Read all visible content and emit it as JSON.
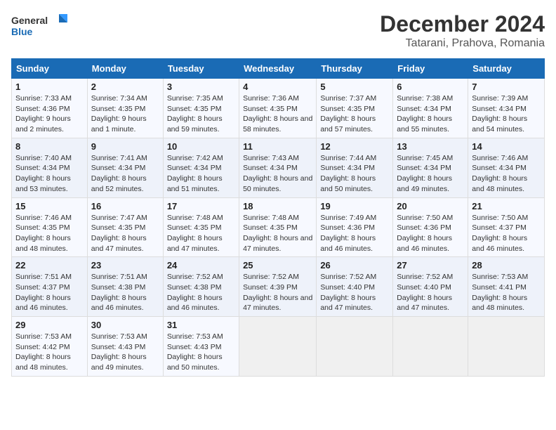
{
  "header": {
    "logo_text_general": "General",
    "logo_text_blue": "Blue",
    "title": "December 2024",
    "subtitle": "Tatarani, Prahova, Romania"
  },
  "calendar": {
    "days_of_week": [
      "Sunday",
      "Monday",
      "Tuesday",
      "Wednesday",
      "Thursday",
      "Friday",
      "Saturday"
    ],
    "weeks": [
      [
        {
          "day": "1",
          "sunrise": "7:33 AM",
          "sunset": "4:36 PM",
          "daylight": "9 hours and 2 minutes."
        },
        {
          "day": "2",
          "sunrise": "7:34 AM",
          "sunset": "4:35 PM",
          "daylight": "9 hours and 1 minute."
        },
        {
          "day": "3",
          "sunrise": "7:35 AM",
          "sunset": "4:35 PM",
          "daylight": "8 hours and 59 minutes."
        },
        {
          "day": "4",
          "sunrise": "7:36 AM",
          "sunset": "4:35 PM",
          "daylight": "8 hours and 58 minutes."
        },
        {
          "day": "5",
          "sunrise": "7:37 AM",
          "sunset": "4:35 PM",
          "daylight": "8 hours and 57 minutes."
        },
        {
          "day": "6",
          "sunrise": "7:38 AM",
          "sunset": "4:34 PM",
          "daylight": "8 hours and 55 minutes."
        },
        {
          "day": "7",
          "sunrise": "7:39 AM",
          "sunset": "4:34 PM",
          "daylight": "8 hours and 54 minutes."
        }
      ],
      [
        {
          "day": "8",
          "sunrise": "7:40 AM",
          "sunset": "4:34 PM",
          "daylight": "8 hours and 53 minutes."
        },
        {
          "day": "9",
          "sunrise": "7:41 AM",
          "sunset": "4:34 PM",
          "daylight": "8 hours and 52 minutes."
        },
        {
          "day": "10",
          "sunrise": "7:42 AM",
          "sunset": "4:34 PM",
          "daylight": "8 hours and 51 minutes."
        },
        {
          "day": "11",
          "sunrise": "7:43 AM",
          "sunset": "4:34 PM",
          "daylight": "8 hours and 50 minutes."
        },
        {
          "day": "12",
          "sunrise": "7:44 AM",
          "sunset": "4:34 PM",
          "daylight": "8 hours and 50 minutes."
        },
        {
          "day": "13",
          "sunrise": "7:45 AM",
          "sunset": "4:34 PM",
          "daylight": "8 hours and 49 minutes."
        },
        {
          "day": "14",
          "sunrise": "7:46 AM",
          "sunset": "4:34 PM",
          "daylight": "8 hours and 48 minutes."
        }
      ],
      [
        {
          "day": "15",
          "sunrise": "7:46 AM",
          "sunset": "4:35 PM",
          "daylight": "8 hours and 48 minutes."
        },
        {
          "day": "16",
          "sunrise": "7:47 AM",
          "sunset": "4:35 PM",
          "daylight": "8 hours and 47 minutes."
        },
        {
          "day": "17",
          "sunrise": "7:48 AM",
          "sunset": "4:35 PM",
          "daylight": "8 hours and 47 minutes."
        },
        {
          "day": "18",
          "sunrise": "7:48 AM",
          "sunset": "4:35 PM",
          "daylight": "8 hours and 47 minutes."
        },
        {
          "day": "19",
          "sunrise": "7:49 AM",
          "sunset": "4:36 PM",
          "daylight": "8 hours and 46 minutes."
        },
        {
          "day": "20",
          "sunrise": "7:50 AM",
          "sunset": "4:36 PM",
          "daylight": "8 hours and 46 minutes."
        },
        {
          "day": "21",
          "sunrise": "7:50 AM",
          "sunset": "4:37 PM",
          "daylight": "8 hours and 46 minutes."
        }
      ],
      [
        {
          "day": "22",
          "sunrise": "7:51 AM",
          "sunset": "4:37 PM",
          "daylight": "8 hours and 46 minutes."
        },
        {
          "day": "23",
          "sunrise": "7:51 AM",
          "sunset": "4:38 PM",
          "daylight": "8 hours and 46 minutes."
        },
        {
          "day": "24",
          "sunrise": "7:52 AM",
          "sunset": "4:38 PM",
          "daylight": "8 hours and 46 minutes."
        },
        {
          "day": "25",
          "sunrise": "7:52 AM",
          "sunset": "4:39 PM",
          "daylight": "8 hours and 47 minutes."
        },
        {
          "day": "26",
          "sunrise": "7:52 AM",
          "sunset": "4:40 PM",
          "daylight": "8 hours and 47 minutes."
        },
        {
          "day": "27",
          "sunrise": "7:52 AM",
          "sunset": "4:40 PM",
          "daylight": "8 hours and 47 minutes."
        },
        {
          "day": "28",
          "sunrise": "7:53 AM",
          "sunset": "4:41 PM",
          "daylight": "8 hours and 48 minutes."
        }
      ],
      [
        {
          "day": "29",
          "sunrise": "7:53 AM",
          "sunset": "4:42 PM",
          "daylight": "8 hours and 48 minutes."
        },
        {
          "day": "30",
          "sunrise": "7:53 AM",
          "sunset": "4:43 PM",
          "daylight": "8 hours and 49 minutes."
        },
        {
          "day": "31",
          "sunrise": "7:53 AM",
          "sunset": "4:43 PM",
          "daylight": "8 hours and 50 minutes."
        },
        null,
        null,
        null,
        null
      ]
    ]
  }
}
